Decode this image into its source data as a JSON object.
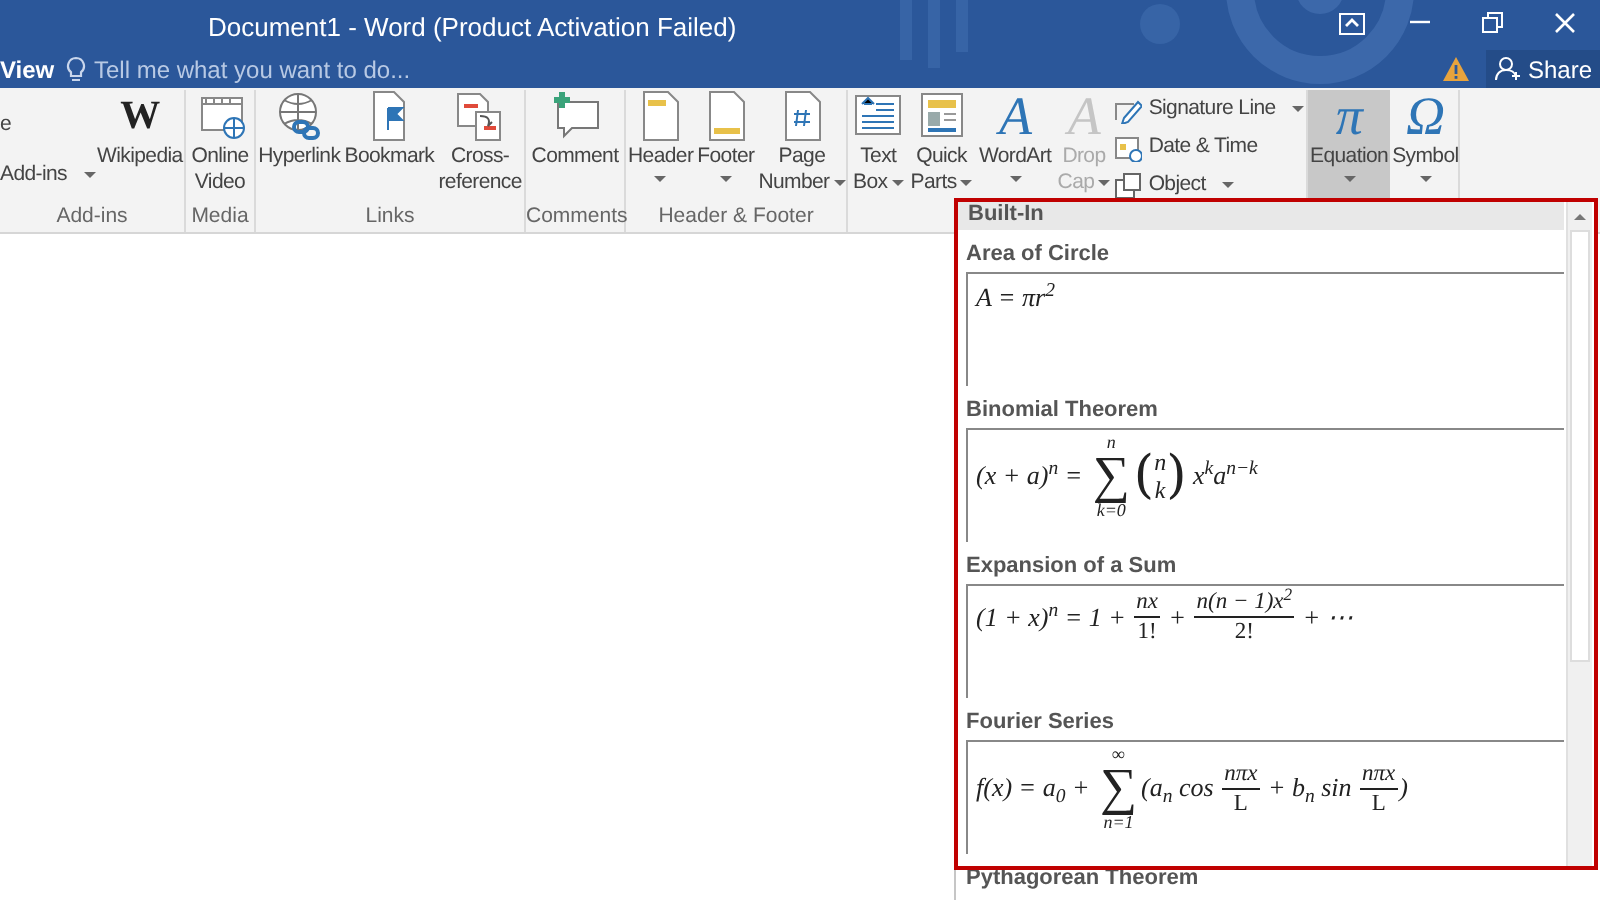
{
  "window": {
    "title": "Document1 - Word (Product Activation Failed)"
  },
  "menu_tab": {
    "label": "View"
  },
  "tell_me": {
    "placeholder": "Tell me what you want to do..."
  },
  "share": {
    "label": "Share"
  },
  "ribbon": {
    "groups": [
      {
        "label": "Add-ins",
        "items": [
          {
            "kind": "stack",
            "entries": [
              {
                "label": "e",
                "caret": false
              },
              {
                "label": "Add-ins",
                "caret": true
              }
            ]
          },
          {
            "kind": "large",
            "glyph": "W",
            "lines": [
              "Wikipedia"
            ],
            "dropdown": false,
            "disabled": false,
            "selected": false
          }
        ]
      },
      {
        "label": "Media",
        "items": [
          {
            "kind": "large",
            "lines": [
              "Online",
              "Video"
            ],
            "dropdown": false,
            "disabled": false,
            "selected": false
          }
        ]
      },
      {
        "label": "Links",
        "items": [
          {
            "kind": "large",
            "lines": [
              "Hyperlink"
            ],
            "dropdown": false,
            "disabled": false,
            "selected": false
          },
          {
            "kind": "large",
            "lines": [
              "Bookmark"
            ],
            "dropdown": false,
            "disabled": false,
            "selected": false
          },
          {
            "kind": "large",
            "lines": [
              "Cross-",
              "reference"
            ],
            "dropdown": false,
            "disabled": false,
            "selected": false
          }
        ]
      },
      {
        "label": "Comments",
        "items": [
          {
            "kind": "large",
            "lines": [
              "Comment"
            ],
            "dropdown": false,
            "disabled": false,
            "selected": false
          }
        ]
      },
      {
        "label": "Header & Footer",
        "items": [
          {
            "kind": "large",
            "lines": [
              "Header"
            ],
            "dropdown": true,
            "disabled": false,
            "selected": false
          },
          {
            "kind": "large",
            "lines": [
              "Footer"
            ],
            "dropdown": true,
            "disabled": false,
            "selected": false
          },
          {
            "kind": "large",
            "lines": [
              "Page",
              "Number"
            ],
            "dropdown": true,
            "disabled": false,
            "selected": false
          }
        ]
      },
      {
        "items": [
          {
            "kind": "large",
            "lines": [
              "Text",
              "Box"
            ],
            "dropdown": true,
            "disabled": false,
            "selected": false
          },
          {
            "kind": "large",
            "lines": [
              "Quick",
              "Parts"
            ],
            "dropdown": true,
            "disabled": false,
            "selected": false
          },
          {
            "kind": "large",
            "glyph": "A",
            "lines": [
              "WordArt"
            ],
            "dropdown": true,
            "disabled": false,
            "selected": false
          },
          {
            "kind": "large",
            "glyph": "A",
            "lines": [
              "Drop",
              "Cap"
            ],
            "dropdown": true,
            "disabled": true,
            "selected": false
          },
          {
            "kind": "stack",
            "entries": [
              {
                "label": "Signature Line",
                "caret": true
              },
              {
                "label": "Date & Time",
                "caret": false
              },
              {
                "label": "Object",
                "caret": true
              }
            ]
          }
        ]
      },
      {
        "items": [
          {
            "kind": "large",
            "glyph": "π",
            "lines": [
              "Equation"
            ],
            "dropdown": true,
            "disabled": false,
            "selected": true
          },
          {
            "kind": "large",
            "glyph": "Ω",
            "lines": [
              "Symbol"
            ],
            "dropdown": true,
            "disabled": false,
            "selected": false
          }
        ]
      }
    ]
  },
  "equation_gallery": {
    "header": "Built-In",
    "items": [
      {
        "title": "Area of Circle",
        "parts": [
          {
            "kind": "text",
            "text": "A = πr$^{2}$"
          }
        ]
      },
      {
        "title": "Binomial Theorem",
        "parts": [
          {
            "kind": "text",
            "text": "(x + a)$^{n}$ = "
          },
          {
            "kind": "sum",
            "symbol": "∑",
            "upper": "n",
            "lower": "k=0"
          },
          {
            "kind": "binom",
            "open": "(",
            "top": "n",
            "bottom": "k",
            "close": ")"
          },
          {
            "kind": "text",
            "text": " x$^{k}$a$^{n−k}$"
          }
        ]
      },
      {
        "title": "Expansion of a Sum",
        "parts": [
          {
            "kind": "text",
            "text": "(1 + x)$^{n}$ = 1 + "
          },
          {
            "kind": "frac",
            "num": "nx",
            "den": "1!"
          },
          {
            "kind": "text",
            "text": " + "
          },
          {
            "kind": "frac",
            "num": "n(n − 1)x$^{2}$",
            "den": "2!"
          },
          {
            "kind": "text",
            "text": " + ⋯"
          }
        ]
      },
      {
        "title": "Fourier Series",
        "parts": [
          {
            "kind": "text",
            "text": "f(x) = a$_{0}$ + "
          },
          {
            "kind": "sum",
            "symbol": "∑",
            "upper": "∞",
            "lower": "n=1"
          },
          {
            "kind": "text",
            "text": "(a$_{n}$ cos "
          },
          {
            "kind": "frac",
            "num": "nπx",
            "den": "L"
          },
          {
            "kind": "text",
            "text": " + b$_{n}$ sin "
          },
          {
            "kind": "frac",
            "num": "nπx",
            "den": "L"
          },
          {
            "kind": "text",
            "text": ")"
          }
        ]
      },
      {
        "title": "Pythagorean Theorem"
      }
    ]
  }
}
